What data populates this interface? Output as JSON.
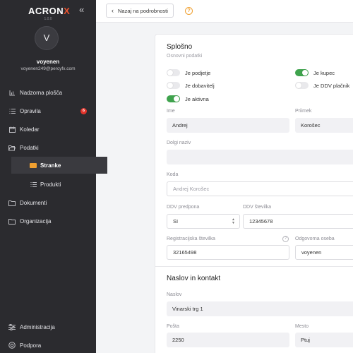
{
  "app": {
    "logo_main": "ACRON",
    "logo_accent": "X",
    "version": "1.0.0",
    "accent_color": "#e8522f"
  },
  "user": {
    "initial": "V",
    "name": "voyenen",
    "email": "voyenen249@percyfx.com"
  },
  "sidebar": {
    "items": [
      {
        "label": "Nadzorna plošča",
        "icon": "bar-chart-icon"
      },
      {
        "label": "Opravila",
        "icon": "list-icon",
        "badge": "6"
      },
      {
        "label": "Koledar",
        "icon": "calendar-icon"
      },
      {
        "label": "Podatki",
        "icon": "folder-open-icon"
      },
      {
        "label": "Stranke",
        "icon": "contact-card-icon",
        "active": true
      },
      {
        "label": "Produkti",
        "icon": "list-icon"
      },
      {
        "label": "Dokumenti",
        "icon": "folder-icon"
      },
      {
        "label": "Organizacija",
        "icon": "folder-icon"
      }
    ],
    "bottom": [
      {
        "label": "Administracija",
        "icon": "sliders-icon"
      },
      {
        "label": "Podpora",
        "icon": "support-icon"
      }
    ]
  },
  "topbar": {
    "back_label": "Nazaj na podrobnosti",
    "help_symbol": "?"
  },
  "general": {
    "title": "Splošno",
    "subtitle": "Osnovni podatki",
    "toggles": [
      {
        "label": "Je podjetje",
        "on": false
      },
      {
        "label": "Je kupec",
        "on": true
      },
      {
        "label": "Je dobavitelj",
        "on": false
      },
      {
        "label": "Je DDV plačnik",
        "on": false
      },
      {
        "label": "Je aktivna",
        "on": true
      }
    ],
    "fields": {
      "ime": {
        "label": "Ime",
        "value": "Andrej"
      },
      "priimek": {
        "label": "Priimek",
        "value": "Korošec"
      },
      "dolgi_naziv": {
        "label": "Dolgi naziv",
        "value": ""
      },
      "koda": {
        "label": "Koda",
        "placeholder": "Andrej Korošec"
      },
      "ddv_predpona": {
        "label": "DDV predpona",
        "value": "SI"
      },
      "ddv_stevilka": {
        "label": "DDV številka",
        "value": "12345678"
      },
      "registracijska": {
        "label": "Registracijska številka",
        "value": "32165498"
      },
      "odgovorna": {
        "label": "Odgovorna oseba",
        "value": "voyenen"
      }
    }
  },
  "address": {
    "title": "Naslov in kontakt",
    "fields": {
      "naslov": {
        "label": "Naslov",
        "value": "Vinarski trg 1"
      },
      "posta": {
        "label": "Pošta",
        "value": "2250"
      },
      "mesto": {
        "label": "Mesto",
        "value": "Ptuj"
      }
    }
  }
}
